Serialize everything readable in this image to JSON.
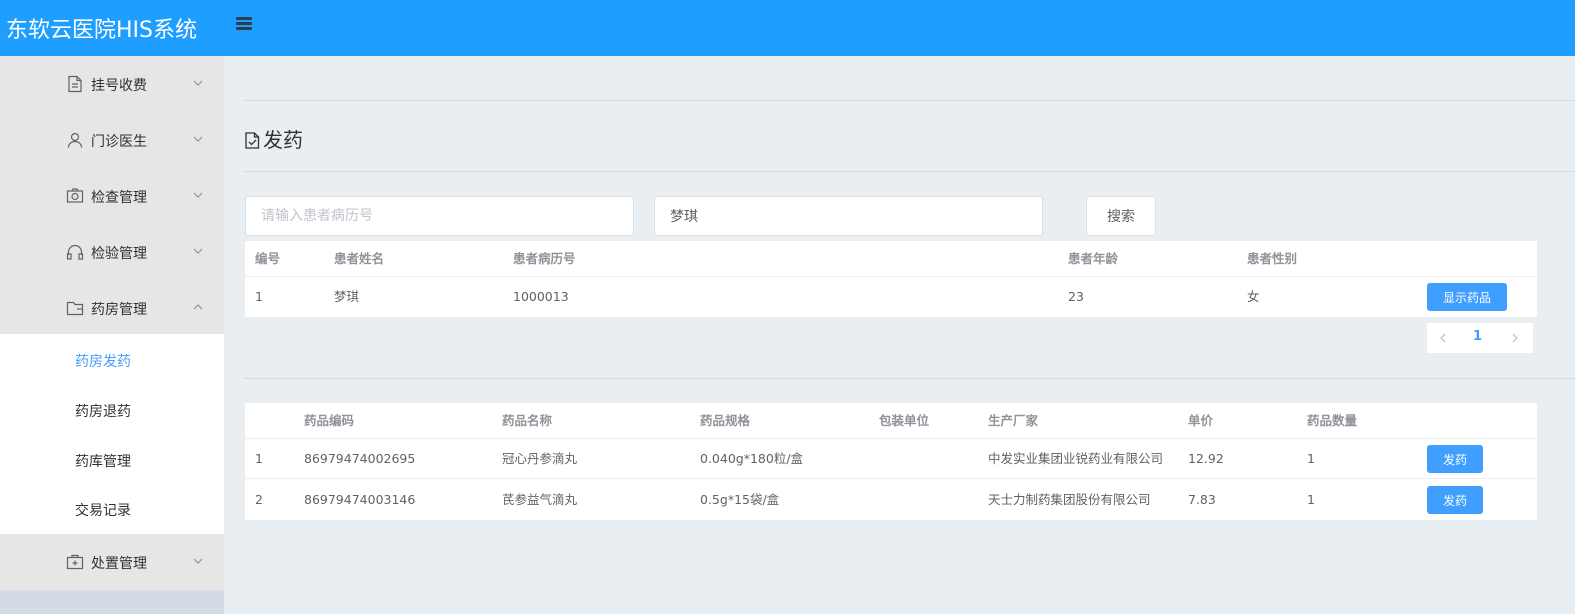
{
  "header": {
    "title": "东软云医院HIS系统",
    "menu_icon": "hamburger-icon"
  },
  "sidebar": {
    "groups": [
      {
        "label": "挂号收费",
        "icon": "document-icon"
      },
      {
        "label": "门诊医生",
        "icon": "user-icon"
      },
      {
        "label": "检查管理",
        "icon": "camera-icon"
      },
      {
        "label": "检验管理",
        "icon": "headset-icon"
      },
      {
        "label": "药房管理",
        "icon": "wallet-icon"
      },
      {
        "label": "处置管理",
        "icon": "first-aid-icon"
      }
    ],
    "submenu": [
      {
        "label": "药房发药"
      },
      {
        "label": "药房退药"
      },
      {
        "label": "药库管理"
      },
      {
        "label": "交易记录"
      }
    ]
  },
  "page": {
    "title": "发药"
  },
  "search": {
    "record_placeholder": "请输入患者病历号",
    "name_value": "梦琪",
    "button": "搜索"
  },
  "patients": {
    "headers": [
      "编号",
      "患者姓名",
      "患者病历号",
      "患者年龄",
      "患者性别"
    ],
    "rows": [
      {
        "no": "1",
        "name": "梦琪",
        "record": "1000013",
        "age": "23",
        "gender": "女",
        "action": "显示药品"
      }
    ]
  },
  "pagination": {
    "current": "1"
  },
  "drugs": {
    "headers": [
      "药品编码",
      "药品名称",
      "药品规格",
      "包装单位",
      "生产厂家",
      "单价",
      "药品数量"
    ],
    "rows": [
      {
        "no": "1",
        "code": "86979474002695",
        "name": "冠心丹参滴丸",
        "spec": "0.040g*180粒/盒",
        "unit": "",
        "maker": "中发实业集团业锐药业有限公司",
        "price": "12.92",
        "qty": "1",
        "action": "发药"
      },
      {
        "no": "2",
        "code": "86979474003146",
        "name": "芪参益气滴丸",
        "spec": "0.5g*15袋/盒",
        "unit": "",
        "maker": "天士力制药集团股份有限公司",
        "price": "7.83",
        "qty": "1",
        "action": "发药"
      }
    ]
  },
  "colors": {
    "header": "#1e9fff",
    "primary": "#409eff",
    "sidebar": "#e6e6e6",
    "background": "#e9eef3"
  }
}
